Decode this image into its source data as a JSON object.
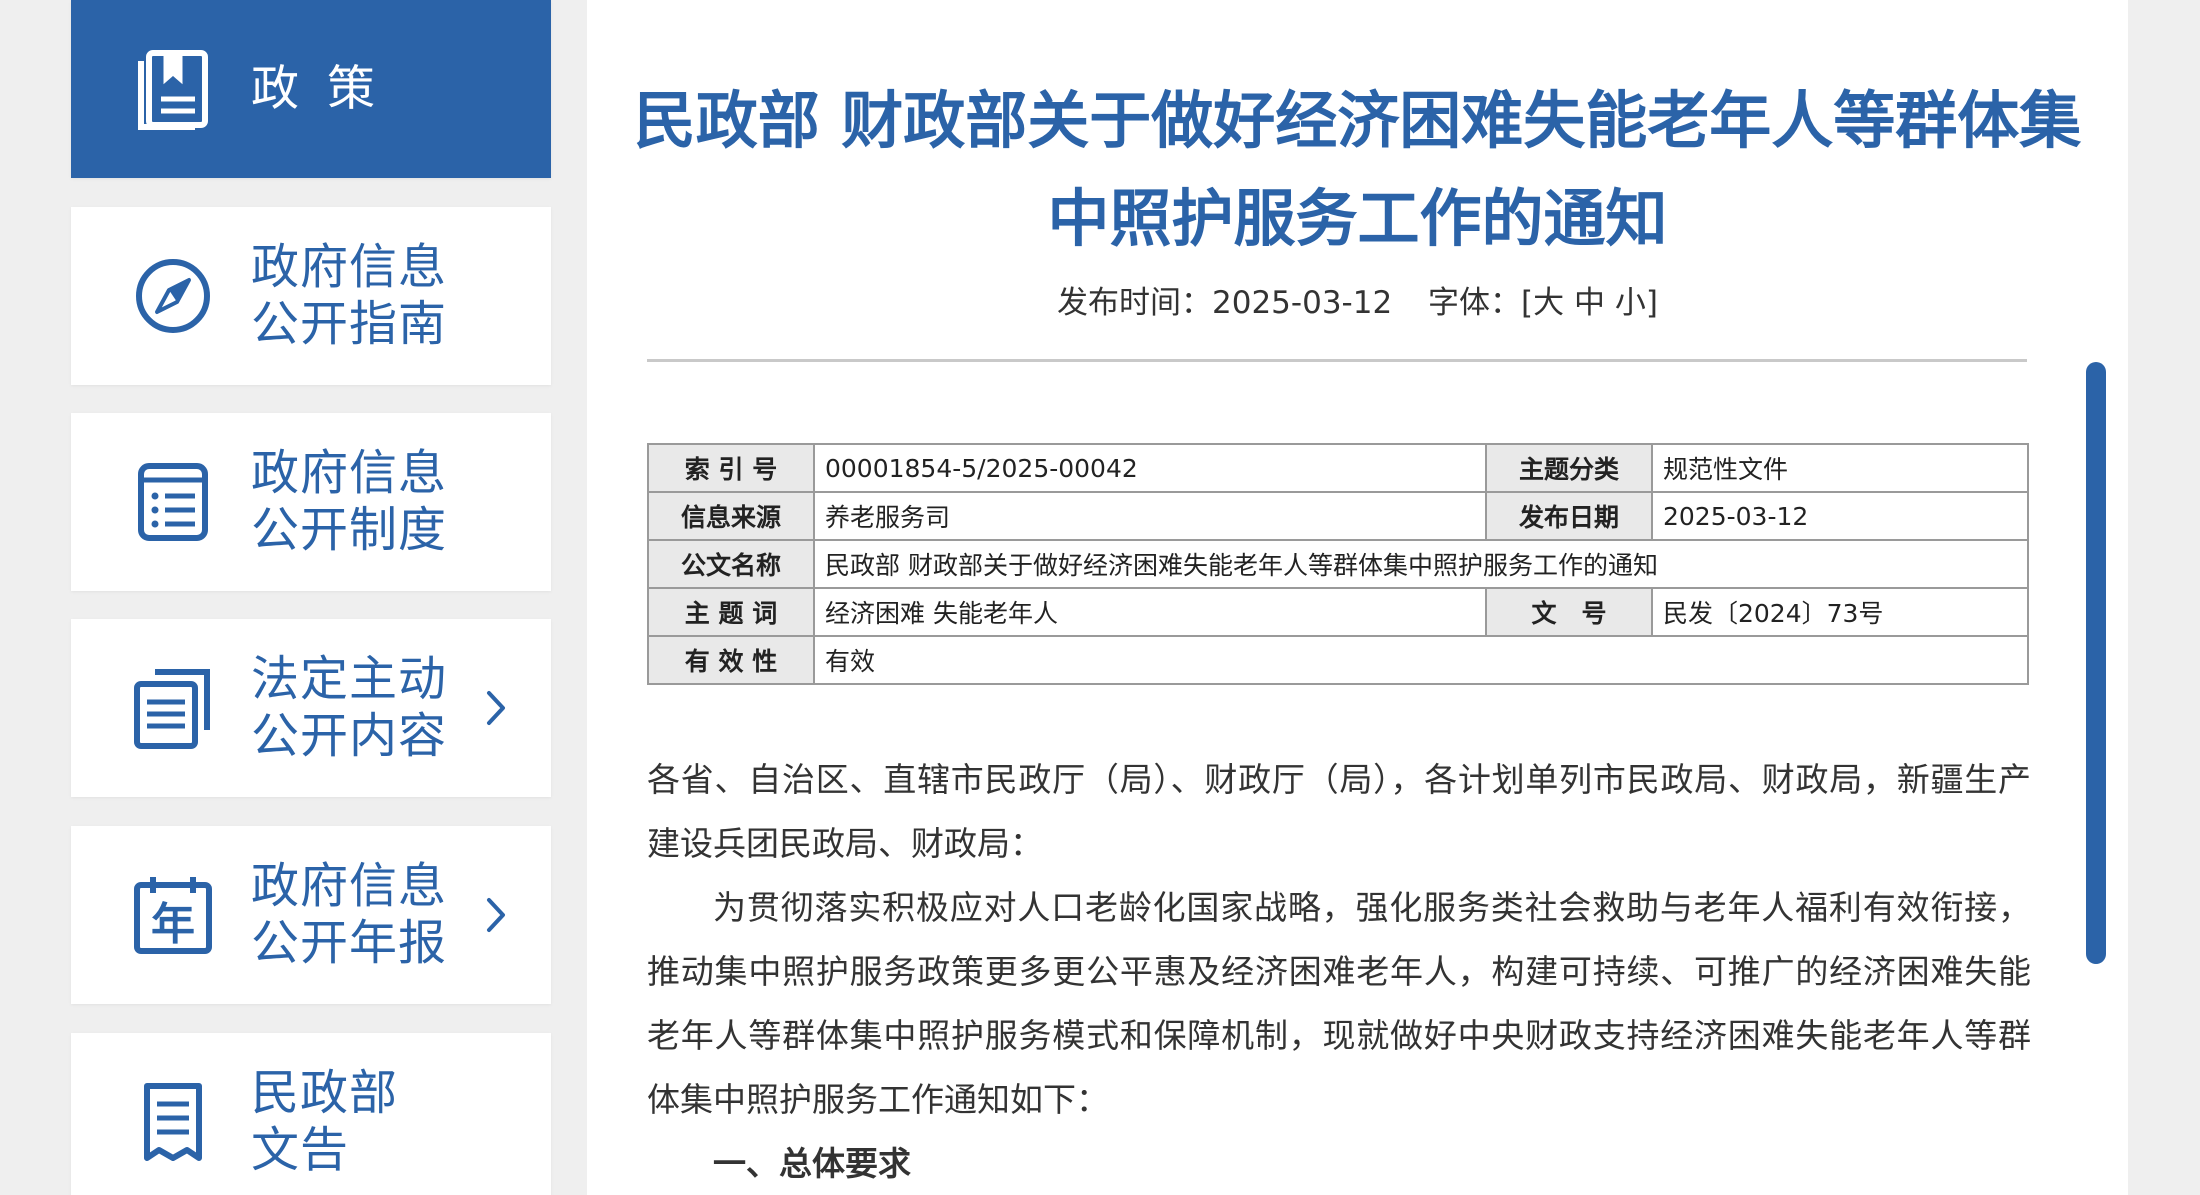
{
  "sidebar": {
    "items": [
      {
        "label": "政策",
        "icon": "policy-book-icon",
        "active": true,
        "chevron": false
      },
      {
        "label": "政府信息\n公开指南",
        "icon": "compass-icon",
        "active": false,
        "chevron": false
      },
      {
        "label": "政府信息\n公开制度",
        "icon": "list-document-icon",
        "active": false,
        "chevron": false
      },
      {
        "label": "法定主动\n公开内容",
        "icon": "stacked-documents-icon",
        "active": false,
        "chevron": true
      },
      {
        "label": "政府信息\n公开年报",
        "icon": "annual-report-calendar-icon",
        "active": false,
        "chevron": true
      },
      {
        "label": "民政部\n文告",
        "icon": "announcement-scroll-icon",
        "active": false,
        "chevron": false
      }
    ],
    "annual_icon_char": "年"
  },
  "article": {
    "title": "民政部 财政部关于做好经济困难失能老年人等群体集中照护服务工作的通知",
    "publish_label": "发布时间：",
    "publish_date": "2025-03-12",
    "font_label": "字体：",
    "font_open": "[",
    "font_large": "大",
    "font_medium": "中",
    "font_small": "小",
    "font_close": "]"
  },
  "info_table": {
    "rows": [
      {
        "label1": "索 引 号",
        "value1": "00001854-5/2025-00042",
        "label2": "主题分类",
        "value2": "规范性文件"
      },
      {
        "label1": "信息来源",
        "value1": "养老服务司",
        "label2": "发布日期",
        "value2": "2025-03-12"
      },
      {
        "label1": "公文名称",
        "value1": "民政部 财政部关于做好经济困难失能老年人等群体集中照护服务工作的通知"
      },
      {
        "label1": "主 题 词",
        "value1": "经济困难 失能老年人",
        "label2": "文　号",
        "value2": "民发〔2024〕73号"
      },
      {
        "label1": "有 效 性",
        "value1": "有效"
      }
    ]
  },
  "body": {
    "salutation": "各省、自治区、直辖市民政厅（局）、财政厅（局），各计划单列市民政局、财政局，新疆生产建设兵团民政局、财政局：",
    "paragraph1": "为贯彻落实积极应对人口老龄化国家战略，强化服务类社会救助与老年人福利有效衔接，推动集中照护服务政策更多更公平惠及经济困难老年人，构建可持续、可推广的经济困难失能老年人等群体集中照护服务模式和保障机制，现就做好中央财政支持经济困难失能老年人等群体集中照护服务工作通知如下：",
    "section1": "一、总体要求"
  },
  "colors": {
    "accent": "#2b63a8",
    "background": "#efefef",
    "table_label_bg": "#e9e9e9"
  }
}
